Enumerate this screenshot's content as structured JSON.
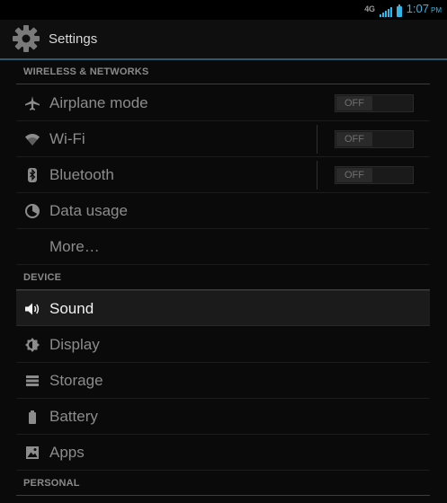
{
  "status_bar": {
    "network_type": "4G",
    "time": "1:07",
    "ampm": "PM",
    "accent_color": "#33b5e5"
  },
  "action_bar": {
    "title": "Settings",
    "icon": "settings-gear-icon"
  },
  "sections": [
    {
      "header": "WIRELESS & NETWORKS",
      "items": [
        {
          "label": "Airplane mode",
          "icon": "airplane-icon",
          "toggle": "OFF"
        },
        {
          "label": "Wi-Fi",
          "icon": "wifi-icon",
          "toggle": "OFF"
        },
        {
          "label": "Bluetooth",
          "icon": "bluetooth-icon",
          "toggle": "OFF"
        },
        {
          "label": "Data usage",
          "icon": "data-usage-icon"
        },
        {
          "label": "More…"
        }
      ]
    },
    {
      "header": "DEVICE",
      "items": [
        {
          "label": "Sound",
          "icon": "sound-icon",
          "selected": true
        },
        {
          "label": "Display",
          "icon": "display-icon"
        },
        {
          "label": "Storage",
          "icon": "storage-icon"
        },
        {
          "label": "Battery",
          "icon": "battery-icon"
        },
        {
          "label": "Apps",
          "icon": "apps-icon"
        }
      ]
    },
    {
      "header": "PERSONAL",
      "items": []
    }
  ]
}
